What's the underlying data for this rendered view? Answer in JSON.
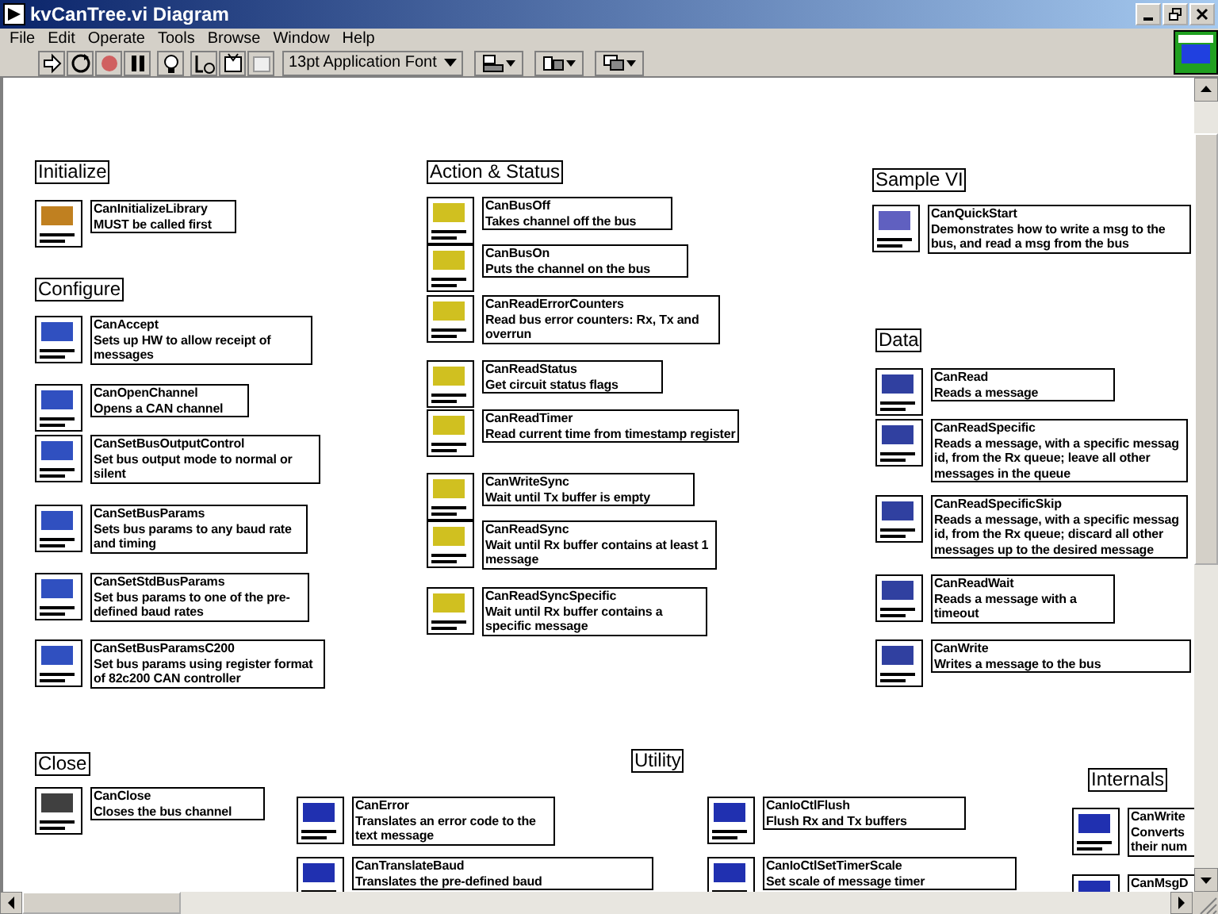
{
  "window": {
    "title": "kvCanTree.vi Diagram"
  },
  "menu": [
    "File",
    "Edit",
    "Operate",
    "Tools",
    "Browse",
    "Window",
    "Help"
  ],
  "toolbar": {
    "font": "13pt Application Font"
  },
  "sections": [
    {
      "title": "Initialize",
      "items": [
        {
          "name": "CanInitializeLibrary",
          "description": "MUST be called first"
        }
      ]
    },
    {
      "title": "Configure",
      "items": [
        {
          "name": "CanAccept",
          "description": "Sets up HW to allow receipt of messages"
        },
        {
          "name": "CanOpenChannel",
          "description": "Opens a CAN channel"
        },
        {
          "name": "CanSetBusOutputControl",
          "description": "Set bus output mode to normal or silent"
        },
        {
          "name": "CanSetBusParams",
          "description": "Sets bus params to any baud rate and timing"
        },
        {
          "name": "CanSetStdBusParams",
          "description": "Set bus params to one of the pre-defined baud rates"
        },
        {
          "name": "CanSetBusParamsC200",
          "description": "Set bus params using register format of 82c200 CAN controller"
        }
      ]
    },
    {
      "title": "Action & Status",
      "items": [
        {
          "name": "CanBusOff",
          "description": "Takes channel off the bus"
        },
        {
          "name": "CanBusOn",
          "description": "Puts the channel on the bus"
        },
        {
          "name": "CanReadErrorCounters",
          "description": "Read bus error counters:  Rx, Tx and overrun"
        },
        {
          "name": "CanReadStatus",
          "description": "Get circuit status flags"
        },
        {
          "name": "CanReadTimer",
          "description": "Read current time from timestamp register"
        },
        {
          "name": "CanWriteSync",
          "description": "Wait until Tx buffer is empty"
        },
        {
          "name": "CanReadSync",
          "description": "Wait until Rx buffer contains at least 1 message"
        },
        {
          "name": "CanReadSyncSpecific",
          "description": "Wait until Rx buffer contains a specific message"
        }
      ]
    },
    {
      "title": "Sample VI",
      "items": [
        {
          "name": "CanQuickStart",
          "description": "Demonstrates how to write a msg to the bus, and read a msg from the bus"
        }
      ]
    },
    {
      "title": "Data",
      "items": [
        {
          "name": "CanRead",
          "description": "Reads a message"
        },
        {
          "name": "CanReadSpecific",
          "description": "Reads a message, with a specific messag id, from the Rx queue; leave all other messages in the queue"
        },
        {
          "name": "CanReadSpecificSkip",
          "description": "Reads a message, with a specific messag id, from the Rx queue; discard all other messages up to the desired message"
        },
        {
          "name": "CanReadWait",
          "description": "Reads a message with a timeout"
        },
        {
          "name": "CanWrite",
          "description": "Writes a message to the bus"
        }
      ]
    },
    {
      "title": "Close",
      "items": [
        {
          "name": "CanClose",
          "description": "Closes the bus channel"
        }
      ]
    },
    {
      "title": "Utility",
      "items": [
        {
          "name": "CanError",
          "description": "Translates an error code to the text message"
        },
        {
          "name": "CanTranslateBaud",
          "description": "Translates the pre-defined baud"
        },
        {
          "name": "CanIoCtlFlush",
          "description": "Flush Rx and Tx buffers"
        },
        {
          "name": "CanIoCtlSetTimerScale",
          "description": "Set scale of message timer"
        }
      ]
    },
    {
      "title": "Internals",
      "items": [
        {
          "name": "CanWrite",
          "description": "Converts their num"
        },
        {
          "name": "CanMsgD"
        }
      ]
    }
  ]
}
